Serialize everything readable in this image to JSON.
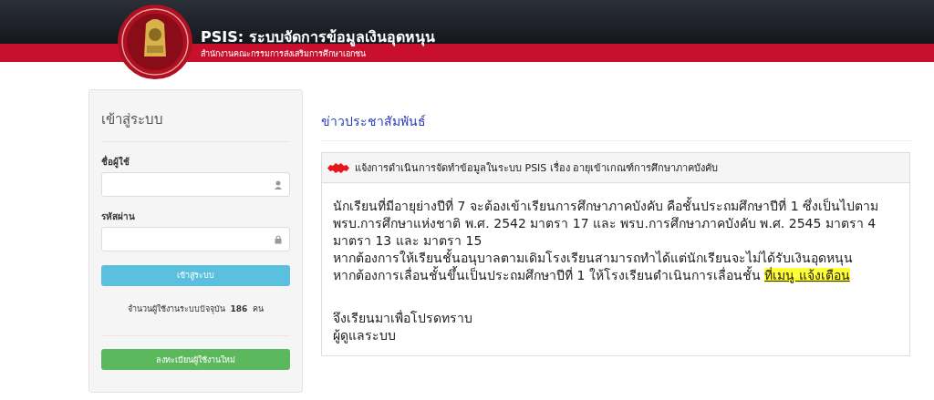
{
  "header": {
    "title": "PSIS: ระบบจัดการข้อมูลเงินอุดหนุน",
    "subtitle": "สำนักงานคณะกรรมการส่งเสริมการศึกษาเอกชน"
  },
  "login": {
    "title": "เข้าสู่ระบบ",
    "fields": [
      {
        "label": "ชื่อผู้ใช้",
        "kind": "user"
      },
      {
        "label": "รหัสผ่าน",
        "kind": "password"
      }
    ],
    "login_button": "เข้าสู่ระบบ",
    "user_count": {
      "prefix": "จำนวนผู้ใช้งานระบบปัจจุบัน",
      "count": "186",
      "suffix": "คน"
    },
    "register_button": "ลงทะเบียนผู้ใช้งานใหม่"
  },
  "news": {
    "heading": "ข่าวประชาสัมพันธ์",
    "notice": {
      "title": "แจ้งการดำเนินการจัดทำข้อมูลในระบบ PSIS เรื่อง อายุเข้าเกณฑ์การศึกษาภาคบังคับ",
      "paragraphs": [
        "นักเรียนที่มีอายุย่างปีที่ 7 จะต้องเข้าเรียนการศึกษาภาคบังคับ คือชั้นประถมศึกษาปีที่ 1  ซึ่งเป็นไปตาม พรบ.การศึกษาแห่งชาติ พ.ศ. 2542 มาตรา 17 และ พรบ.การศึกษาภาคบังคับ พ.ศ. 2545 มาตรา 4 มาตรา 13 และ มาตรา 15",
        "หากต้องการให้เรียนชั้นอนุบาลตามเดิมโรงเรียนสามารถทำได้แต่นักเรียนจะไม่ได้รับเงินอุดหนุน"
      ],
      "action": {
        "text": "หากต้องการเลื่อนชั้นขึ้นเป็นประถมศึกษาปีที่ 1 ให้โรงเรียนดำเนินการเลื่อนชั้น",
        "link": "ที่เมนู แจ้งเตือน"
      },
      "closing": [
        "จึงเรียนมาเพื่อโปรดทราบ",
        "ผู้ดูแลระบบ"
      ]
    }
  }
}
